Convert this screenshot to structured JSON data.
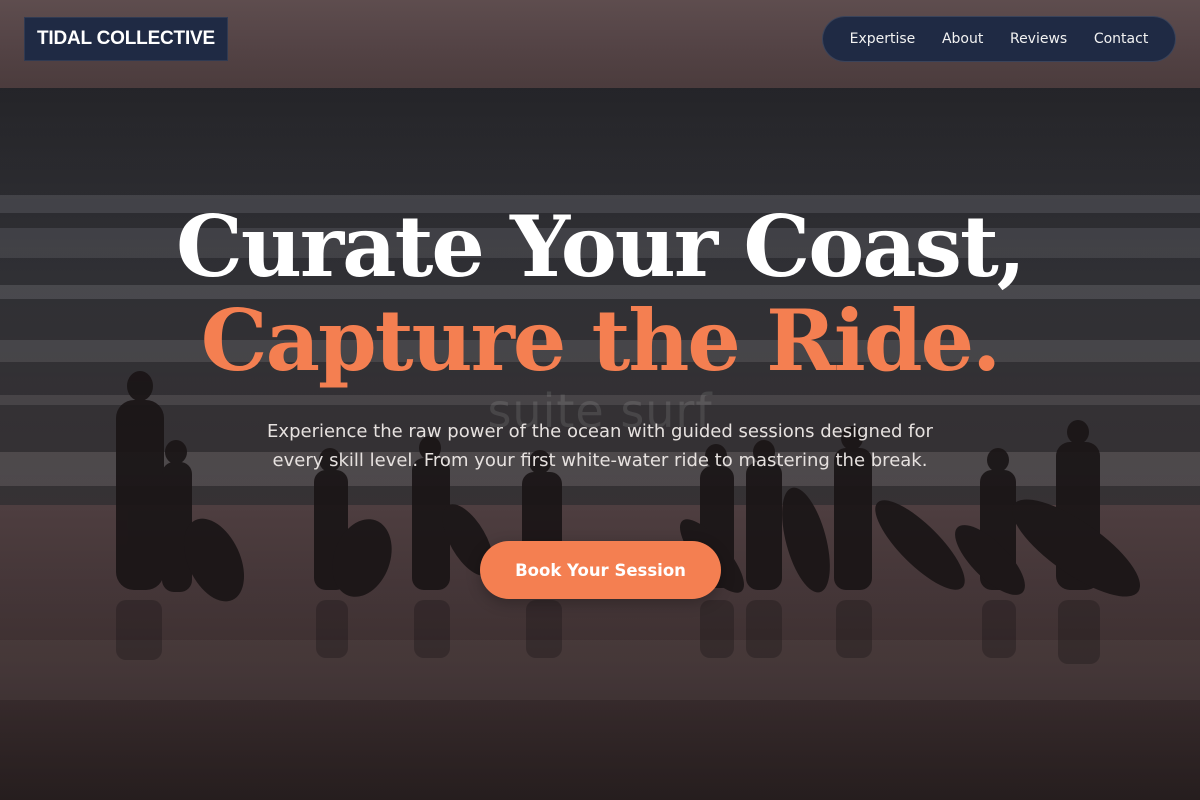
{
  "brand": {
    "name": "TIDAL COLLECTIVE"
  },
  "nav": {
    "items": [
      {
        "label": "Expertise"
      },
      {
        "label": "About"
      },
      {
        "label": "Reviews"
      },
      {
        "label": "Contact"
      }
    ]
  },
  "hero": {
    "title_line1": "Curate Your Coast,",
    "title_line2": "Capture the Ride.",
    "watermark": "suite surf",
    "subtitle": "Experience the raw power of the ocean with guided sessions designed for every skill level. From your first white-water ride to mastering the break.",
    "cta_label": "Book Your Session"
  },
  "colors": {
    "accent": "#f47f51",
    "navy": "#1f2a44",
    "text_light": "#ffffff"
  }
}
